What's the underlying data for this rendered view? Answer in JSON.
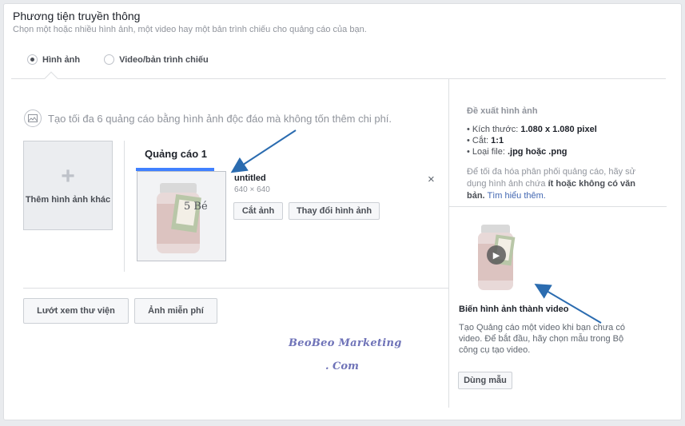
{
  "section": {
    "title": "Phương tiện truyền thông",
    "subtitle": "Chọn một hoặc nhiều hình ảnh, một video hay một bản trình chiếu cho quảng cáo của bạn."
  },
  "media_type": {
    "options": [
      {
        "label": "Hình ảnh",
        "selected": true
      },
      {
        "label": "Video/bản trình chiếu",
        "selected": false
      }
    ]
  },
  "images": {
    "info": "Tạo tối đa 6 quảng cáo bằng hình ảnh độc đáo mà không tốn thêm chi phí.",
    "add_more_label": "Thêm hình ảnh khác",
    "ad_tab": "Quảng cáo 1",
    "file_name": "untitled",
    "file_size": "640 × 640",
    "crop_button": "Cắt ảnh",
    "change_button": "Thay đổi hình ảnh",
    "close_symbol": "×",
    "browse_library_button": "Lướt xem thư viện",
    "free_images_button": "Ảnh miễn phí",
    "product_label": "5 Bé"
  },
  "watermark": {
    "line1": "BeoBeo Marketing",
    "line2": ". Com"
  },
  "recommendation": {
    "title": "Đề xuất hình ảnh",
    "size_label": "Kích thước:",
    "size_value": "1.080 x 1.080 pixel",
    "ratio_label": "Cắt:",
    "ratio_value": "1:1",
    "filetype_label": "Loại file:",
    "filetype_value": ".jpg hoặc .png",
    "text_part1": "Để tối đa hóa phân phối quảng cáo, hãy sử dụng hình ảnh chứa",
    "text_bold": "ít hoặc không có văn bản.",
    "learn_more": "Tìm hiểu thêm."
  },
  "video_promo": {
    "title": "Biến hình ảnh thành video",
    "description": "Tạo Quảng cáo một video khi bạn chưa có video. Để bắt đầu, hãy chọn mẫu trong Bộ công cụ tạo video.",
    "use_template_button": "Dùng mẫu"
  },
  "colors": {
    "accent": "#4080ff",
    "arrow": "#2b6cb0",
    "watermark": "#6f73b8"
  }
}
